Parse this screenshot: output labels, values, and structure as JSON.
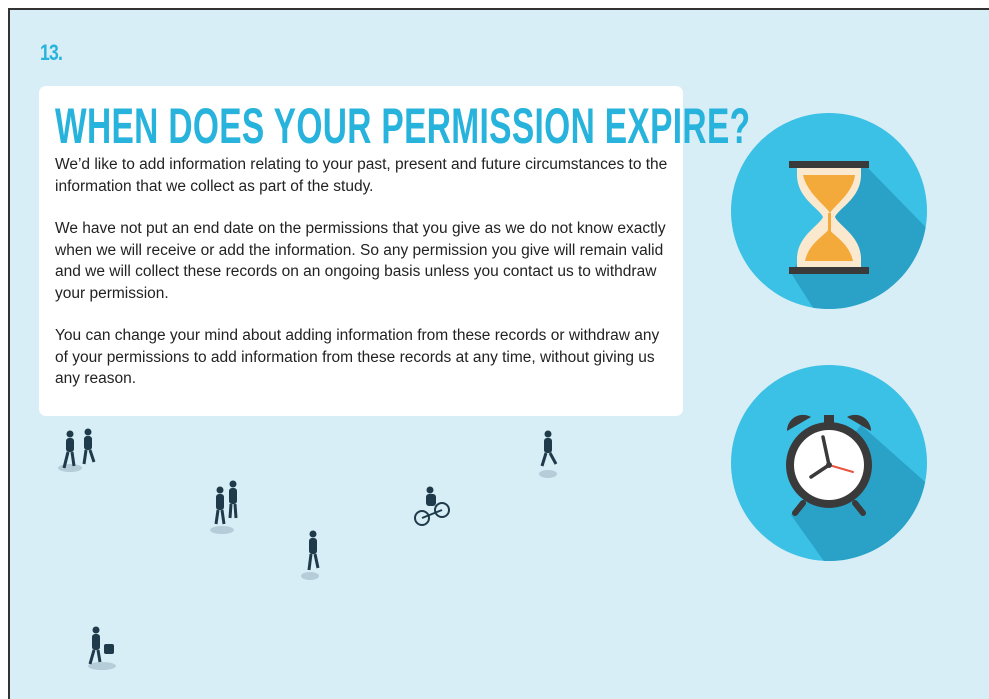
{
  "page": {
    "number": "13.",
    "title": "WHEN DOES YOUR PERMISSION EXPIRE?",
    "paragraphs": [
      "We’d like to add information relating to your past, present and future circumstances to the information that we collect as part of the study.",
      "We have not put an end date on the permissions that you give as we do not know exactly when we will receive or add the information. So any permission you give will remain valid and we will collect these records on an ongoing basis unless you contact us to withdraw your permission.",
      "You can change your mind about adding information from these records or withdraw any of your permissions to add information from these records at any time, without giving us any reason."
    ]
  },
  "icons": {
    "top": "hourglass-icon",
    "bottom": "alarm-clock-icon"
  },
  "colors": {
    "background": "#d8eef6",
    "accent": "#27b3dc",
    "circle": "#3bc0e6",
    "card": "#ffffff",
    "text": "#222222",
    "sand": "#f4a93b"
  }
}
